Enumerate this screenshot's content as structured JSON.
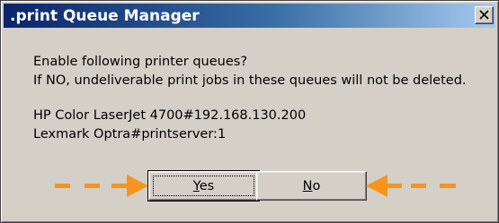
{
  "window": {
    "title": ".print Queue Manager",
    "close_icon": "close-icon"
  },
  "message": {
    "line1": "Enable following printer queues?",
    "line2": "If NO, undeliverable print jobs in these queues will not be deleted."
  },
  "queues": [
    "HP Color LaserJet 4700#192.168.130.200",
    "Lexmark Optra#printserver:1"
  ],
  "buttons": {
    "yes": {
      "accel": "Y",
      "rest": "es"
    },
    "no": {
      "accel": "N",
      "rest": "o"
    }
  },
  "annotation": {
    "color": "#f7941d",
    "left_arrow_icon": "orange-dashed-arrow-right",
    "right_arrow_icon": "orange-dashed-arrow-left"
  },
  "colors": {
    "title_gradient_start": "#0a246a",
    "title_gradient_end": "#a6caf0",
    "face": "#d4d0c8"
  }
}
